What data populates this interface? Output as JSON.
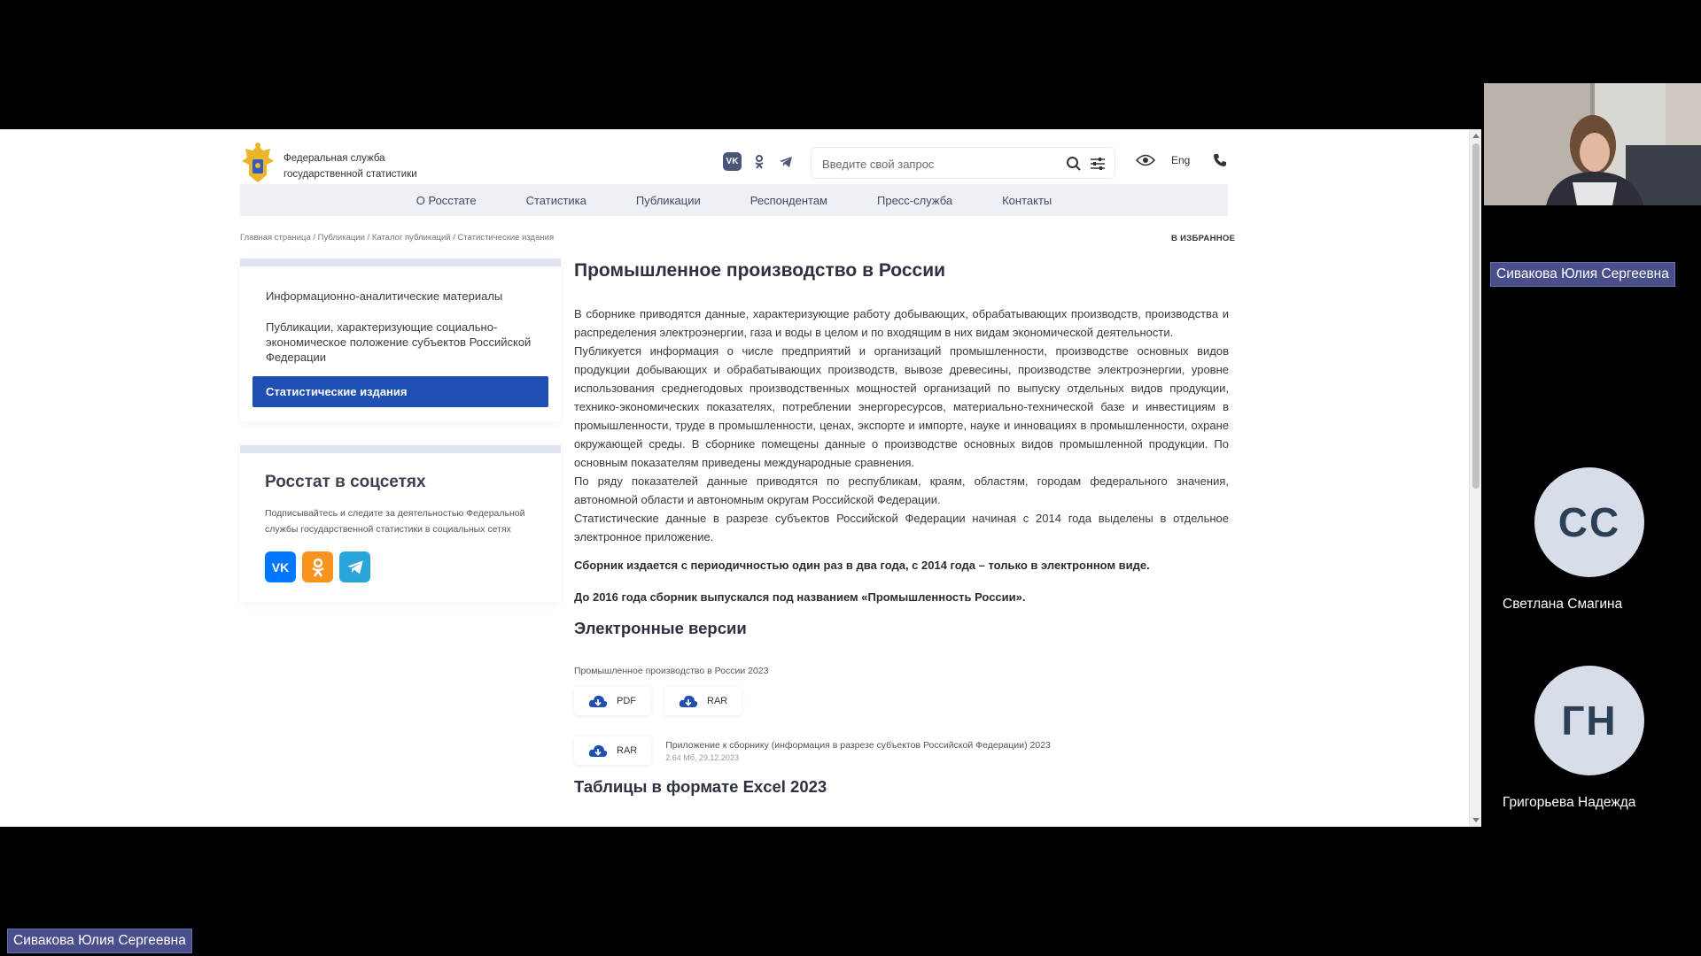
{
  "site": {
    "logo_line1": "Федеральная служба",
    "logo_line2": "государственной статистики",
    "search_placeholder": "Введите свой запрос",
    "lang": "Eng",
    "social_top": [
      "vk-icon",
      "ok-icon",
      "telegram-icon"
    ]
  },
  "nav": {
    "items": [
      "О Росстате",
      "Статистика",
      "Публикации",
      "Респондентам",
      "Пресс-служба",
      "Контакты"
    ]
  },
  "breadcrumb": "Главная страница / Публикации / Каталог публикаций / Статистические издания",
  "favorite_label": "В ИЗБРАННОЕ",
  "sidebar": {
    "items": [
      "Информационно-аналитические материалы",
      "Публикации, характеризующие социально-экономическое положение субъектов Российской Федерации",
      "Статистические издания"
    ],
    "active_index": 2,
    "social_title": "Росстат в соцсетях",
    "social_text": "Подписывайтесь и следите за деятельностью Федеральной службы государственной статистики в социальных сетях",
    "social_labels": [
      "VK",
      "OK",
      "TG"
    ]
  },
  "content": {
    "title": "Промышленное производство в России",
    "paragraphs": [
      "В сборнике приводятся данные, характеризующие работу добывающих, обрабатывающих производств, производства и распределения электроэнергии, газа и воды в целом и по входящим в них видам экономической деятельности.",
      "Публикуется информация о числе предприятий и организаций промышленности, производстве основных видов продукции добывающих и обрабатывающих производств, вывозе древесины, производстве электроэнергии, уровне использования среднегодовых производственных мощностей организаций по выпуску отдельных видов продукции, технико-экономических показателях, потреблении энергоресурсов, материально-технической базе и инвестициям в промышленности, труде в промышленности, ценах, экспорте и импорте, науке и инновациях в промышленности, охране окружающей среды. В сборнике помещены данные о производстве основных видов промышленной продукции. По основным показателям приведены международные сравнения.",
      "По ряду показателей данные приводятся по республикам, краям, областям, городам федерального значения, автономной области и автономным округам Российской Федерации.",
      "Статистические данные в разрезе субъектов Российской Федерации начиная с 2014 года выделены в отдельное электронное приложение."
    ],
    "note1": "Сборник издается с периодичностью один раз в два года, с 2014 года – только в электронном виде.",
    "note2": "До 2016 года сборник выпускался под названием «Промышленность России».",
    "ev_title": "Электронные версии",
    "file_name": "Промышленное производство в России 2023",
    "btn_pdf": "PDF",
    "btn_rar": "RAR",
    "attach_btn": "RAR",
    "attach_title": "Приложение к сборнику (информация в разрезе субъектов Российской Федерации) 2023",
    "attach_meta": "2.64 Мб, 29.12.2023",
    "excel_title": "Таблицы в формате Excel 2023"
  },
  "conference": {
    "presenter_badge": "Сивакова Юлия Сергеевна",
    "participants": [
      {
        "initials": "СС",
        "name": "Светлана Смагина"
      },
      {
        "initials": "ГН",
        "name": "Григорьева Надежда"
      }
    ],
    "bottom_badge": "Сивакова Юлия Сергеевна"
  },
  "colors": {
    "accent": "#1f4fb3",
    "vk": "#0077ff",
    "ok": "#f7931e",
    "telegram": "#2aa5dc",
    "badge": "#4a4f8c"
  }
}
